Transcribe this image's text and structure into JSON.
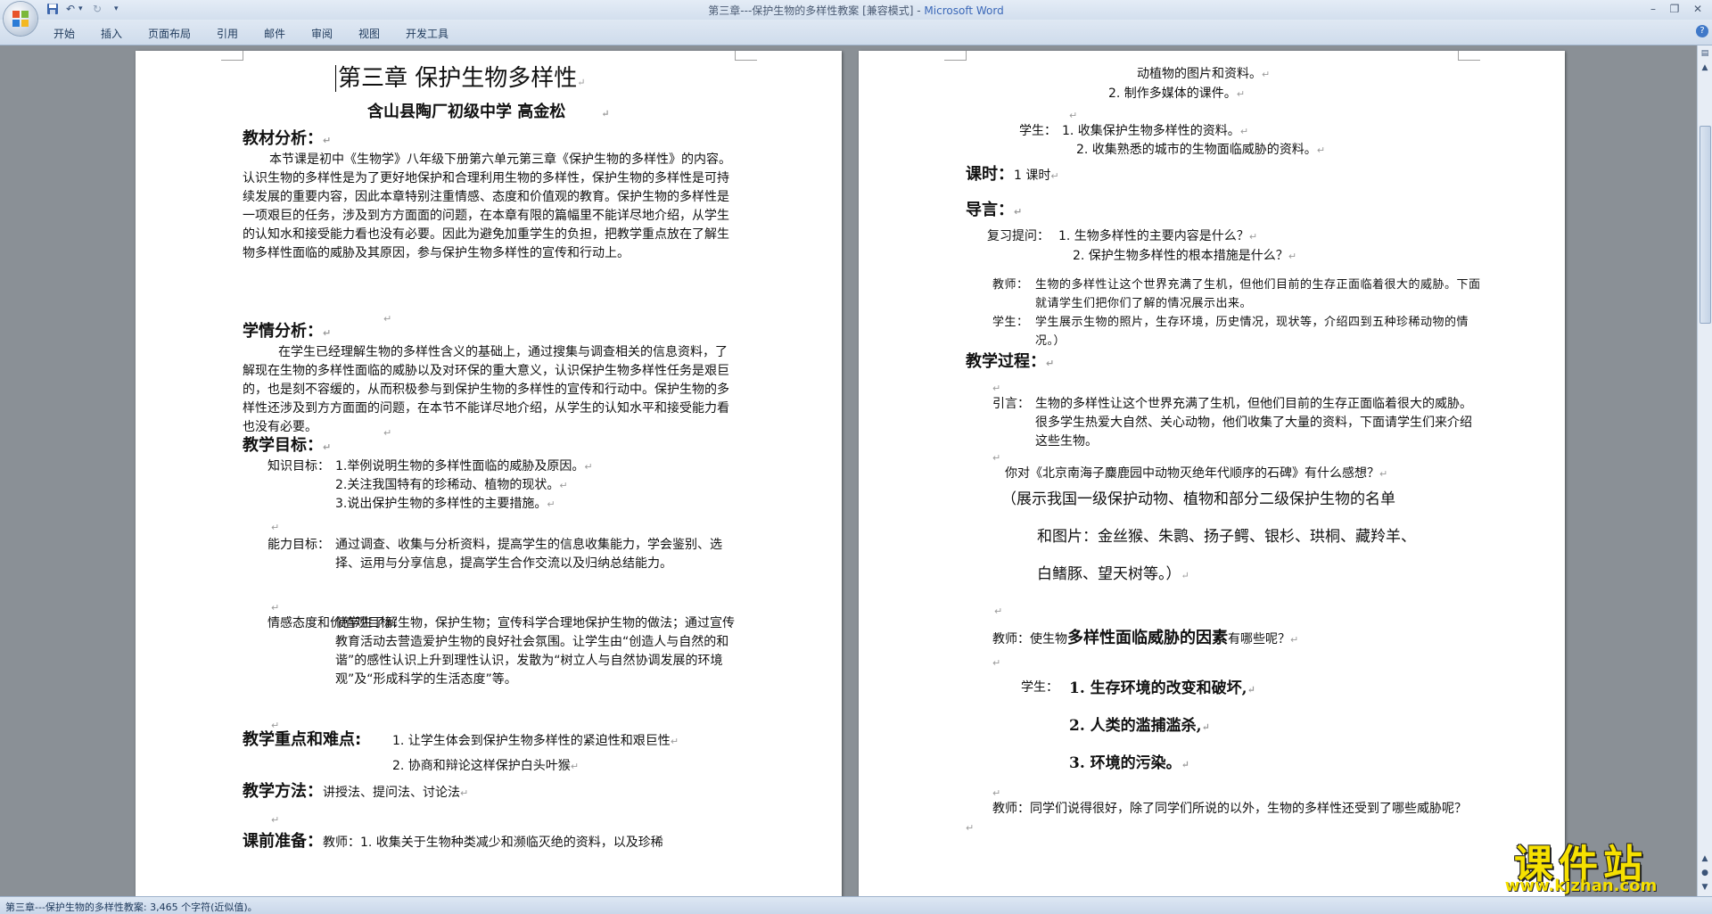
{
  "window": {
    "title": "第三章---保护生物的多样性教案 [兼容模式] - ",
    "app_name": "Microsoft Word",
    "qat_more": "▾"
  },
  "ribbon": {
    "tabs": [
      "开始",
      "插入",
      "页面布局",
      "引用",
      "邮件",
      "审阅",
      "视图",
      "开发工具"
    ]
  },
  "left_page": {
    "title": "第三章   保护生物多样性",
    "author": "含山县陶厂初级中学   高金松",
    "h_material": "教材分析：",
    "material_text": "本节课是初中《生物学》八年级下册第六单元第三章《保护生物的多样性》的内容。认识生物的多样性是为了更好地保护和合理利用生物的多样性，保护生物的多样性是可持续发展的重要内容，因此本章特别注重情感、态度和价值观的教育。保护生物的多样性是一项艰巨的任务，涉及到方方面面的问题，在本章有限的篇幅里不能详尽地介绍，从学生的认知水和接受能力看也没有必要。因此为避免加重学生的负担，把教学重点放在了解生物多样性面临的威胁及其原因，参与保护生物多样性的宣传和行动上。",
    "h_learner": "学情分析：",
    "learner_text": "在学生已经理解生物的多样性含义的基础上，通过搜集与调查相关的信息资料，了解现在生物的多样性面临的威胁以及对环保的重大意义，认识保护生物多样性任务是艰巨的，也是刻不容缓的，从而积极参与到保护生物的多样性的宣传和行动中。保护生物的多样性还涉及到方方面面的问题，在本节不能详尽地介绍，从学生的认知水平和接受能力看也没有必要。",
    "h_goals": "教学目标：",
    "knowledge_label": "知识目标：",
    "knowledge_items": [
      "1.举例说明生物的多样性面临的威胁及原因。",
      "2.关注我国特有的珍稀动、植物的现状。",
      "3.说出保护生物的多样性的主要措施。"
    ],
    "ability_label": "能力目标：",
    "ability_text": "通过调查、收集与分析资料，提高学生的信息收集能力，学会鉴别、选择、运用与分享信息，提高学生合作交流以及归纳总结能力。",
    "emotion_label": "情感态度和价值观目标：",
    "emotion_text": "使学生了解生物，保护生物；宣传科学合理地保护生物的做法；通过宣传教育活动去营造爱护生物的良好社会氛围。让学生由“创造人与自然的和谐”的感性认识上升到理性认识，发散为“树立人与自然协调发展的环境观”及“形成科学的生活态度”等。",
    "h_key": "教学重点和难点:",
    "key_items": [
      "1. 让学生体会到保护生物多样性的紧迫性和艰巨性",
      "2. 协商和辩论这样保护白头叶猴"
    ],
    "h_method": "教学方法：",
    "method_text": "讲授法、提问法、讨论法",
    "h_prep": "课前准备：",
    "prep_text": "教师：1. 收集关于生物种类减少和濒临灭绝的资料，以及珍稀"
  },
  "right_page": {
    "prep_cont": "动植物的图片和资料。",
    "prep_item2": "2. 制作多媒体的课件。",
    "student_label": "学生：",
    "student_items": [
      "1. 收集保护生物多样性的资料。",
      "2. 收集熟悉的城市的生物面临威胁的资料。"
    ],
    "h_period": "课时：",
    "period_text": "1 课时",
    "h_intro": "导言：",
    "review_label": "复习提问：",
    "review_items": [
      "1. 生物多样性的主要内容是什么？",
      "2. 保护生物多样性的根本措施是什么？"
    ],
    "teacher_label": "教师：",
    "teacher_small": "生物的多样性让这个世界充满了生机，但他们目前的生存正面临着很大的威胁。下面就请学生们把你们了解的情况展示出来。",
    "student_small_label": "学生：",
    "student_small": "学生展示生物的照片，生存环境，历史情况，现状等，介绍四到五种珍稀动物的情况。）",
    "h_process": "教学过程：",
    "lead_label": "引言：",
    "lead_text": "生物的多样性让这个世界充满了生机，但他们目前的生存正面临着很大的威胁。很多学生热爱大自然、关心动物，他们收集了大量的资料，下面请学生们来介绍这些生物。",
    "question": "你对《北京南海子麋鹿园中动物灭绝年代顺序的石碑》有什么感想？",
    "show_lines": [
      "（展示我国一级保护动物、植物和部分二级保护生物的名单",
      "和图片：金丝猴、朱鹮、扬子鳄、银杉、珙桐、藏羚羊、",
      "白鳍豚、望天树等。）"
    ],
    "teacher_q_label": "教师：",
    "teacher_q_pre": "使生物",
    "teacher_q_bold": "多样性面临威胁的因素",
    "teacher_q_post": "有哪些呢？",
    "answer_label": "学生：",
    "answers": [
      "1. 生存环境的改变和破坏,",
      "2. 人类的滥捕滥杀,",
      "3. 环境的污染。"
    ],
    "closing_label": "教师：",
    "closing_text": "同学们说得很好，除了同学们所说的以外，生物的多样性还受到了哪些威胁呢？"
  },
  "status": {
    "text": "第三章---保护生物的多样性教案: 3,465 个字符(近似值)。"
  },
  "watermark": {
    "main": "课件站",
    "url": "www.kjzhan.com"
  }
}
